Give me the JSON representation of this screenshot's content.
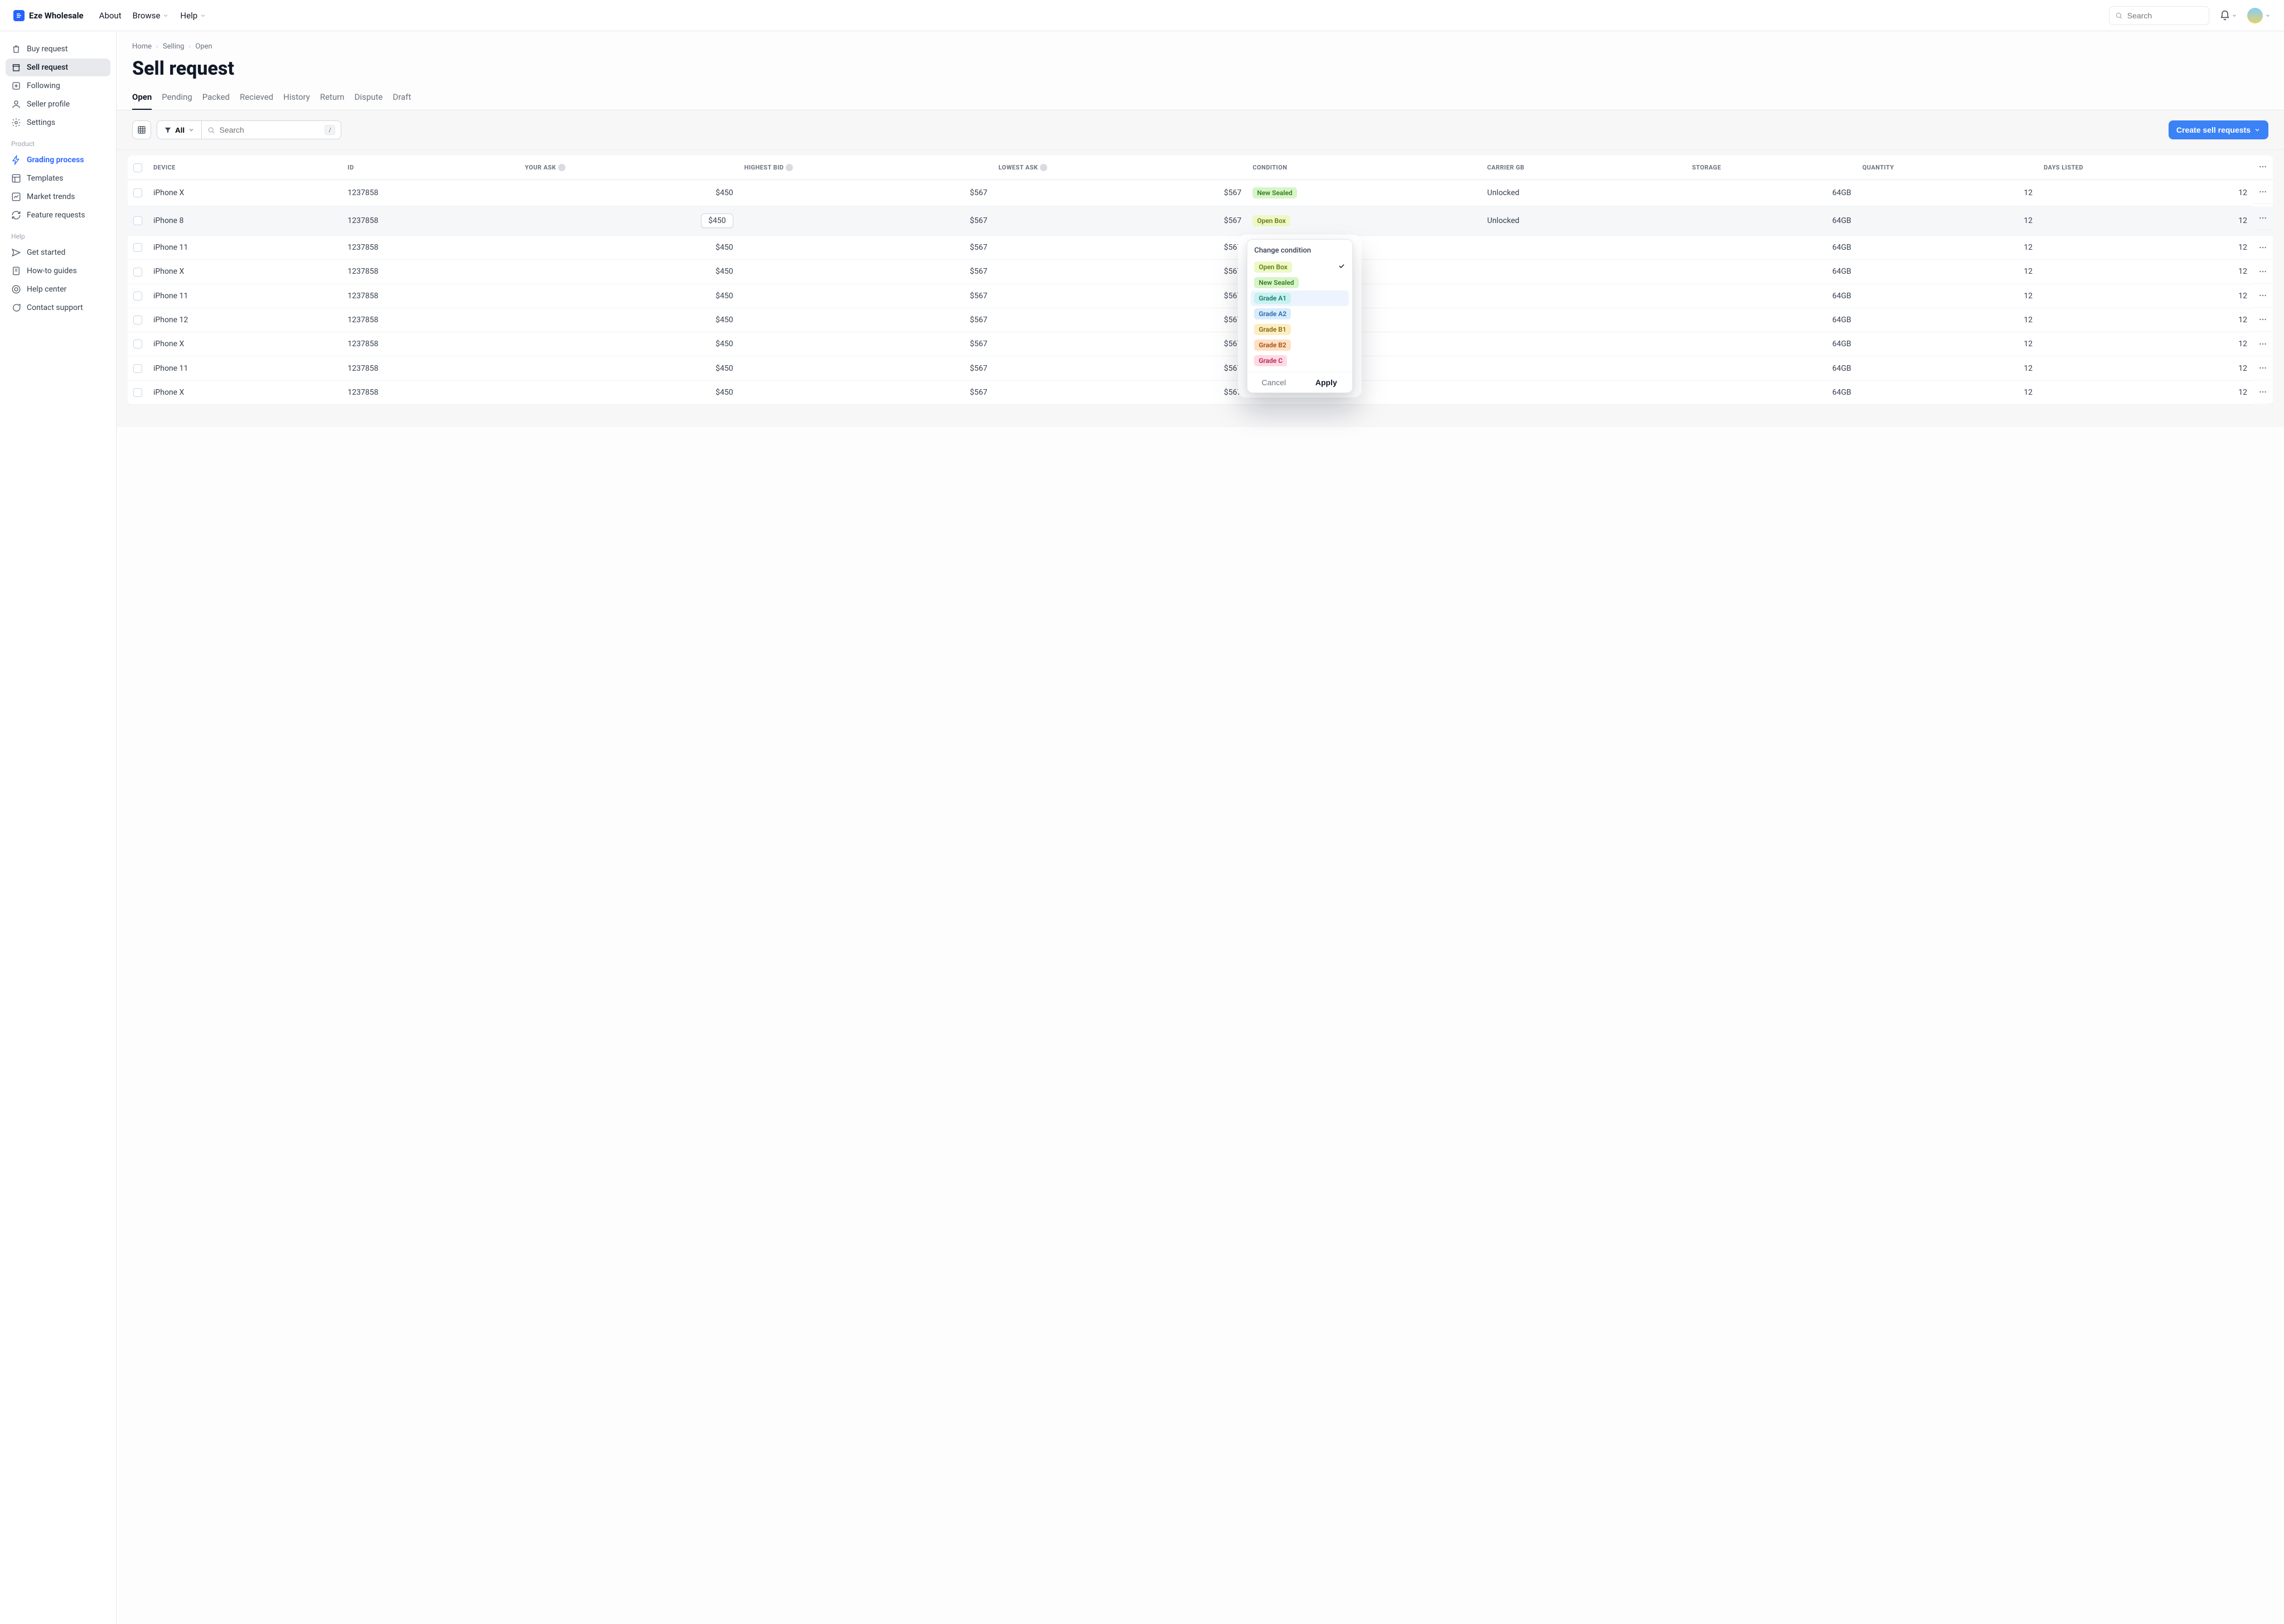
{
  "app": {
    "name": "Eze Wholesale"
  },
  "topnav": {
    "about": "About",
    "browse": "Browse",
    "help": "Help"
  },
  "search": {
    "placeholder": "Search"
  },
  "sidebar": {
    "items": [
      {
        "label": "Buy request"
      },
      {
        "label": "Sell request"
      },
      {
        "label": "Following"
      },
      {
        "label": "Seller profile"
      },
      {
        "label": "Settings"
      }
    ],
    "product_label": "Product",
    "product_items": [
      {
        "label": "Grading process"
      },
      {
        "label": "Templates"
      },
      {
        "label": "Market trends"
      },
      {
        "label": "Feature requests"
      }
    ],
    "help_label": "Help",
    "help_items": [
      {
        "label": "Get started"
      },
      {
        "label": "How-to guides"
      },
      {
        "label": "Help center"
      },
      {
        "label": "Contact support"
      }
    ]
  },
  "breadcrumb": {
    "home": "Home",
    "selling": "Selling",
    "open": "Open"
  },
  "page": {
    "title": "Sell request"
  },
  "tabs": [
    "Open",
    "Pending",
    "Packed",
    "Recieved",
    "History",
    "Return",
    "Dispute",
    "Draft"
  ],
  "toolbar": {
    "filter_label": "All",
    "search_placeholder": "Search",
    "search_kbd": "/",
    "primary": "Create sell requests"
  },
  "columns": {
    "device": "DEVICE",
    "id": "ID",
    "your_ask": "YOUR ASK",
    "highest_bid": "HIGHEST BID",
    "lowest_ask": "LOWEST ASK",
    "condition": "CONDITION",
    "carrier": "CARRIER GB",
    "storage": "STORAGE",
    "quantity": "QUANTITY",
    "days_listed": "DAYS LISTED"
  },
  "rows": [
    {
      "device": "iPhone X",
      "id": "1237858",
      "ask": "$450",
      "bid": "$567",
      "low": "$567",
      "condition_label": "New Sealed",
      "condition_class": "new-sealed",
      "carrier": "Unlocked",
      "storage": "64GB",
      "qty": "12",
      "days": "12"
    },
    {
      "device": "iPhone 8",
      "id": "1237858",
      "ask": "$450",
      "bid": "$567",
      "low": "$567",
      "condition_label": "Open Box",
      "condition_class": "open-box",
      "carrier": "Unlocked",
      "storage": "64GB",
      "qty": "12",
      "days": "12"
    },
    {
      "device": "iPhone 11",
      "id": "1237858",
      "ask": "$450",
      "bid": "$567",
      "low": "$567",
      "condition_label": "",
      "condition_class": "",
      "carrier": "",
      "storage": "64GB",
      "qty": "12",
      "days": "12"
    },
    {
      "device": "iPhone X",
      "id": "1237858",
      "ask": "$450",
      "bid": "$567",
      "low": "$567",
      "condition_label": "",
      "condition_class": "",
      "carrier": "",
      "storage": "64GB",
      "qty": "12",
      "days": "12"
    },
    {
      "device": "iPhone 11",
      "id": "1237858",
      "ask": "$450",
      "bid": "$567",
      "low": "$567",
      "condition_label": "",
      "condition_class": "",
      "carrier": "",
      "storage": "64GB",
      "qty": "12",
      "days": "12"
    },
    {
      "device": "iPhone 12",
      "id": "1237858",
      "ask": "$450",
      "bid": "$567",
      "low": "$567",
      "condition_label": "",
      "condition_class": "",
      "carrier": "",
      "storage": "64GB",
      "qty": "12",
      "days": "12"
    },
    {
      "device": "iPhone X",
      "id": "1237858",
      "ask": "$450",
      "bid": "$567",
      "low": "$567",
      "condition_label": "",
      "condition_class": "",
      "carrier": "",
      "storage": "64GB",
      "qty": "12",
      "days": "12"
    },
    {
      "device": "iPhone 11",
      "id": "1237858",
      "ask": "$450",
      "bid": "$567",
      "low": "$567",
      "condition_label": "",
      "condition_class": "",
      "carrier": "",
      "storage": "64GB",
      "qty": "12",
      "days": "12"
    },
    {
      "device": "iPhone X",
      "id": "1237858",
      "ask": "$450",
      "bid": "$567",
      "low": "$567",
      "condition_label": "",
      "condition_class": "",
      "carrier": "",
      "storage": "64GB",
      "qty": "12",
      "days": "12"
    }
  ],
  "popover": {
    "title": "Change condition",
    "options": [
      {
        "label": "Open Box",
        "class": "open-box",
        "selected": true
      },
      {
        "label": "New Sealed",
        "class": "new-sealed"
      },
      {
        "label": "Grade A1",
        "class": "grade-a1",
        "hover": true
      },
      {
        "label": "Grade A2",
        "class": "grade-a2"
      },
      {
        "label": "Grade B1",
        "class": "grade-b1"
      },
      {
        "label": "Grade B2",
        "class": "grade-b2"
      },
      {
        "label": "Grade C",
        "class": "grade-c"
      }
    ],
    "cancel": "Cancel",
    "apply": "Apply"
  }
}
